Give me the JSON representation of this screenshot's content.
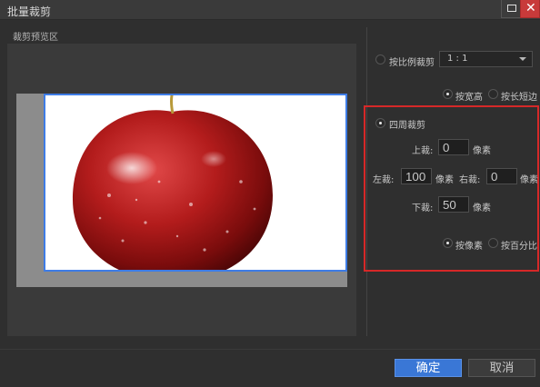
{
  "window": {
    "title": "批量裁剪"
  },
  "preview": {
    "label": "裁剪预览区"
  },
  "ratio_crop": {
    "label": "按比例裁剪",
    "selected": false,
    "ratio_value": "1 : 1"
  },
  "ratio_mode": {
    "by_width_height": {
      "label": "按宽高",
      "selected": true
    },
    "by_long_edge": {
      "label": "按长短边",
      "selected": false
    }
  },
  "edge_crop": {
    "label": "四周裁剪",
    "selected": true,
    "top": {
      "label": "上裁:",
      "value": "0",
      "unit": "像素"
    },
    "left": {
      "label": "左裁:",
      "value": "100",
      "unit": "像素"
    },
    "right": {
      "label": "右裁:",
      "value": "0",
      "unit": "像素"
    },
    "bottom": {
      "label": "下裁:",
      "value": "50",
      "unit": "像素"
    },
    "unit_pixels": {
      "label": "按像素",
      "selected": true
    },
    "unit_percent": {
      "label": "按百分比",
      "selected": false
    }
  },
  "buttons": {
    "ok": "确定",
    "cancel": "取消"
  },
  "colors": {
    "accent": "#3a77d6",
    "highlight_box": "#d62828",
    "crop_frame": "#3e7ce6"
  }
}
